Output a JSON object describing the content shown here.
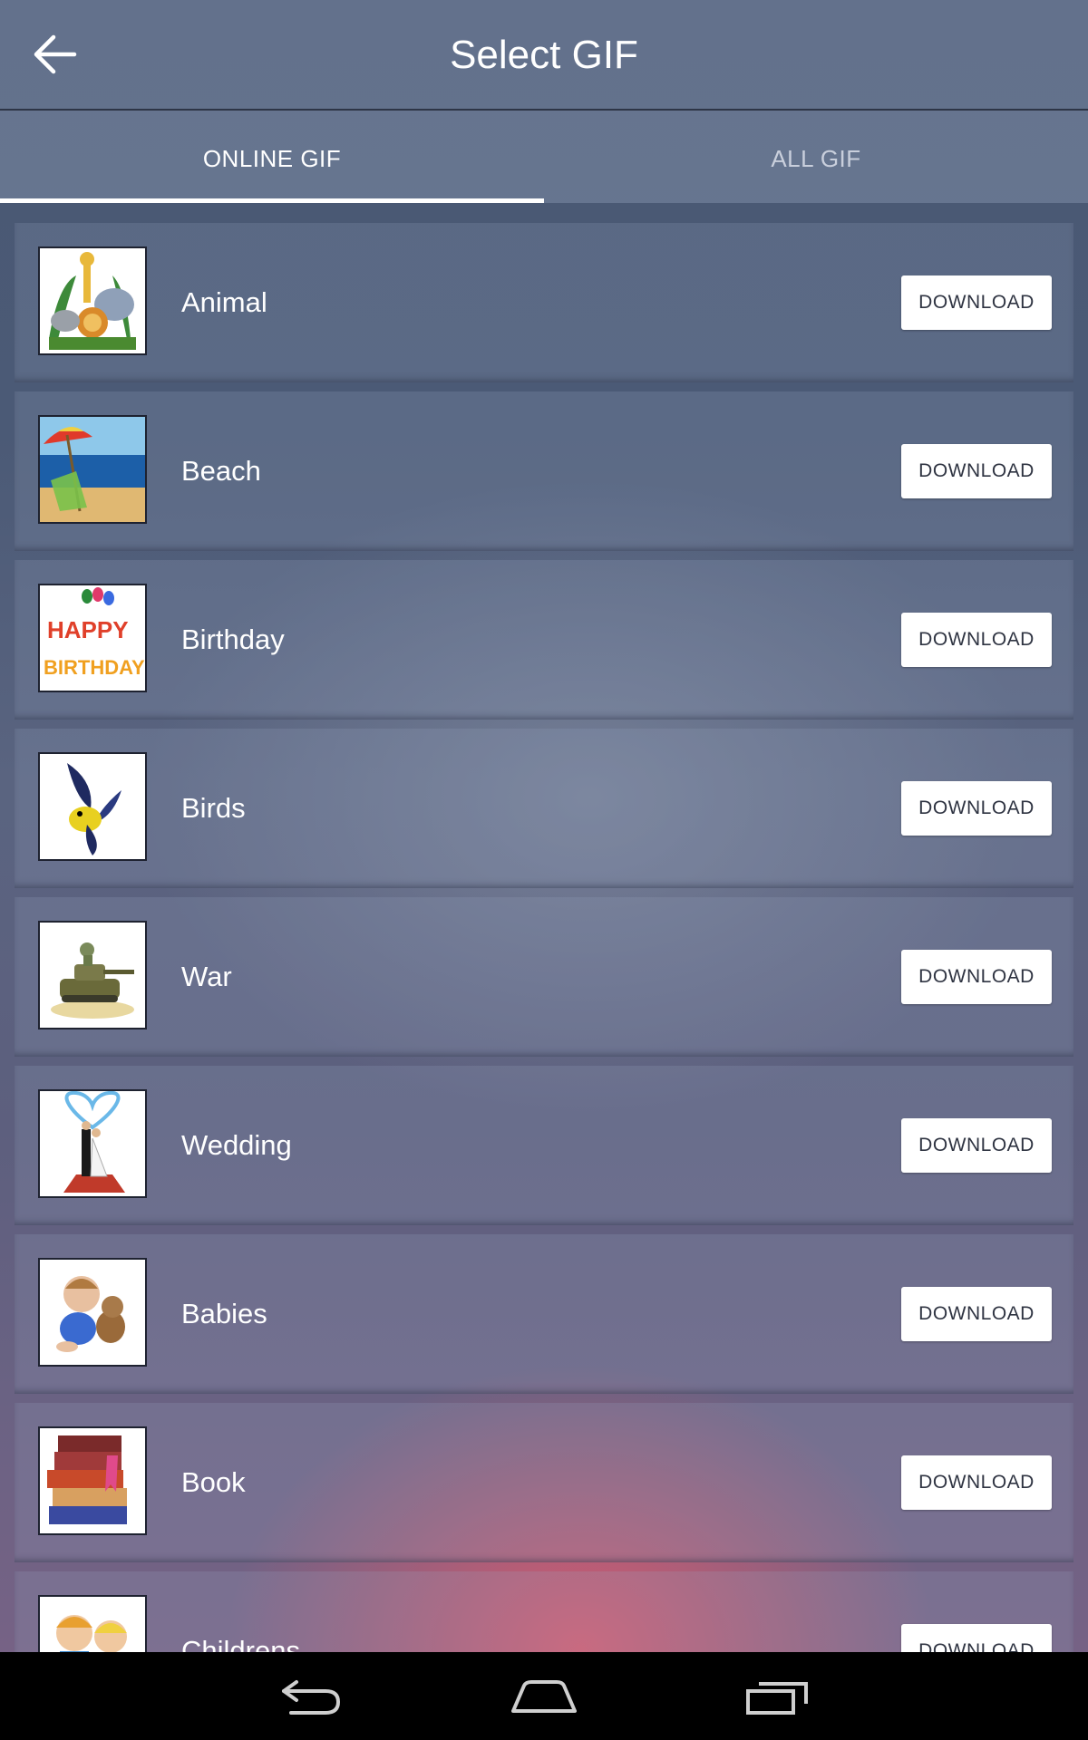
{
  "app_bar": {
    "title": "Select GIF",
    "back_icon": "arrow-left-icon"
  },
  "tabs": [
    {
      "label": "ONLINE GIF",
      "active": true
    },
    {
      "label": "ALL GIF",
      "active": false
    }
  ],
  "download_label": "DOWNLOAD",
  "items": [
    {
      "label": "Animal",
      "thumbnail": "animal-thumbnail"
    },
    {
      "label": "Beach",
      "thumbnail": "beach-thumbnail"
    },
    {
      "label": "Birthday",
      "thumbnail": "birthday-thumbnail"
    },
    {
      "label": "Birds",
      "thumbnail": "birds-thumbnail"
    },
    {
      "label": "War",
      "thumbnail": "war-thumbnail"
    },
    {
      "label": "Wedding",
      "thumbnail": "wedding-thumbnail"
    },
    {
      "label": "Babies",
      "thumbnail": "babies-thumbnail"
    },
    {
      "label": "Book",
      "thumbnail": "book-thumbnail"
    },
    {
      "label": "Childrens",
      "thumbnail": "childrens-thumbnail"
    }
  ],
  "nav_bar": {
    "back": "nav-back-icon",
    "home": "nav-home-icon",
    "recents": "nav-recents-icon"
  },
  "colors": {
    "accent": "#ffffff",
    "button_text": "#2f3442",
    "nav_bar": "#000000"
  }
}
